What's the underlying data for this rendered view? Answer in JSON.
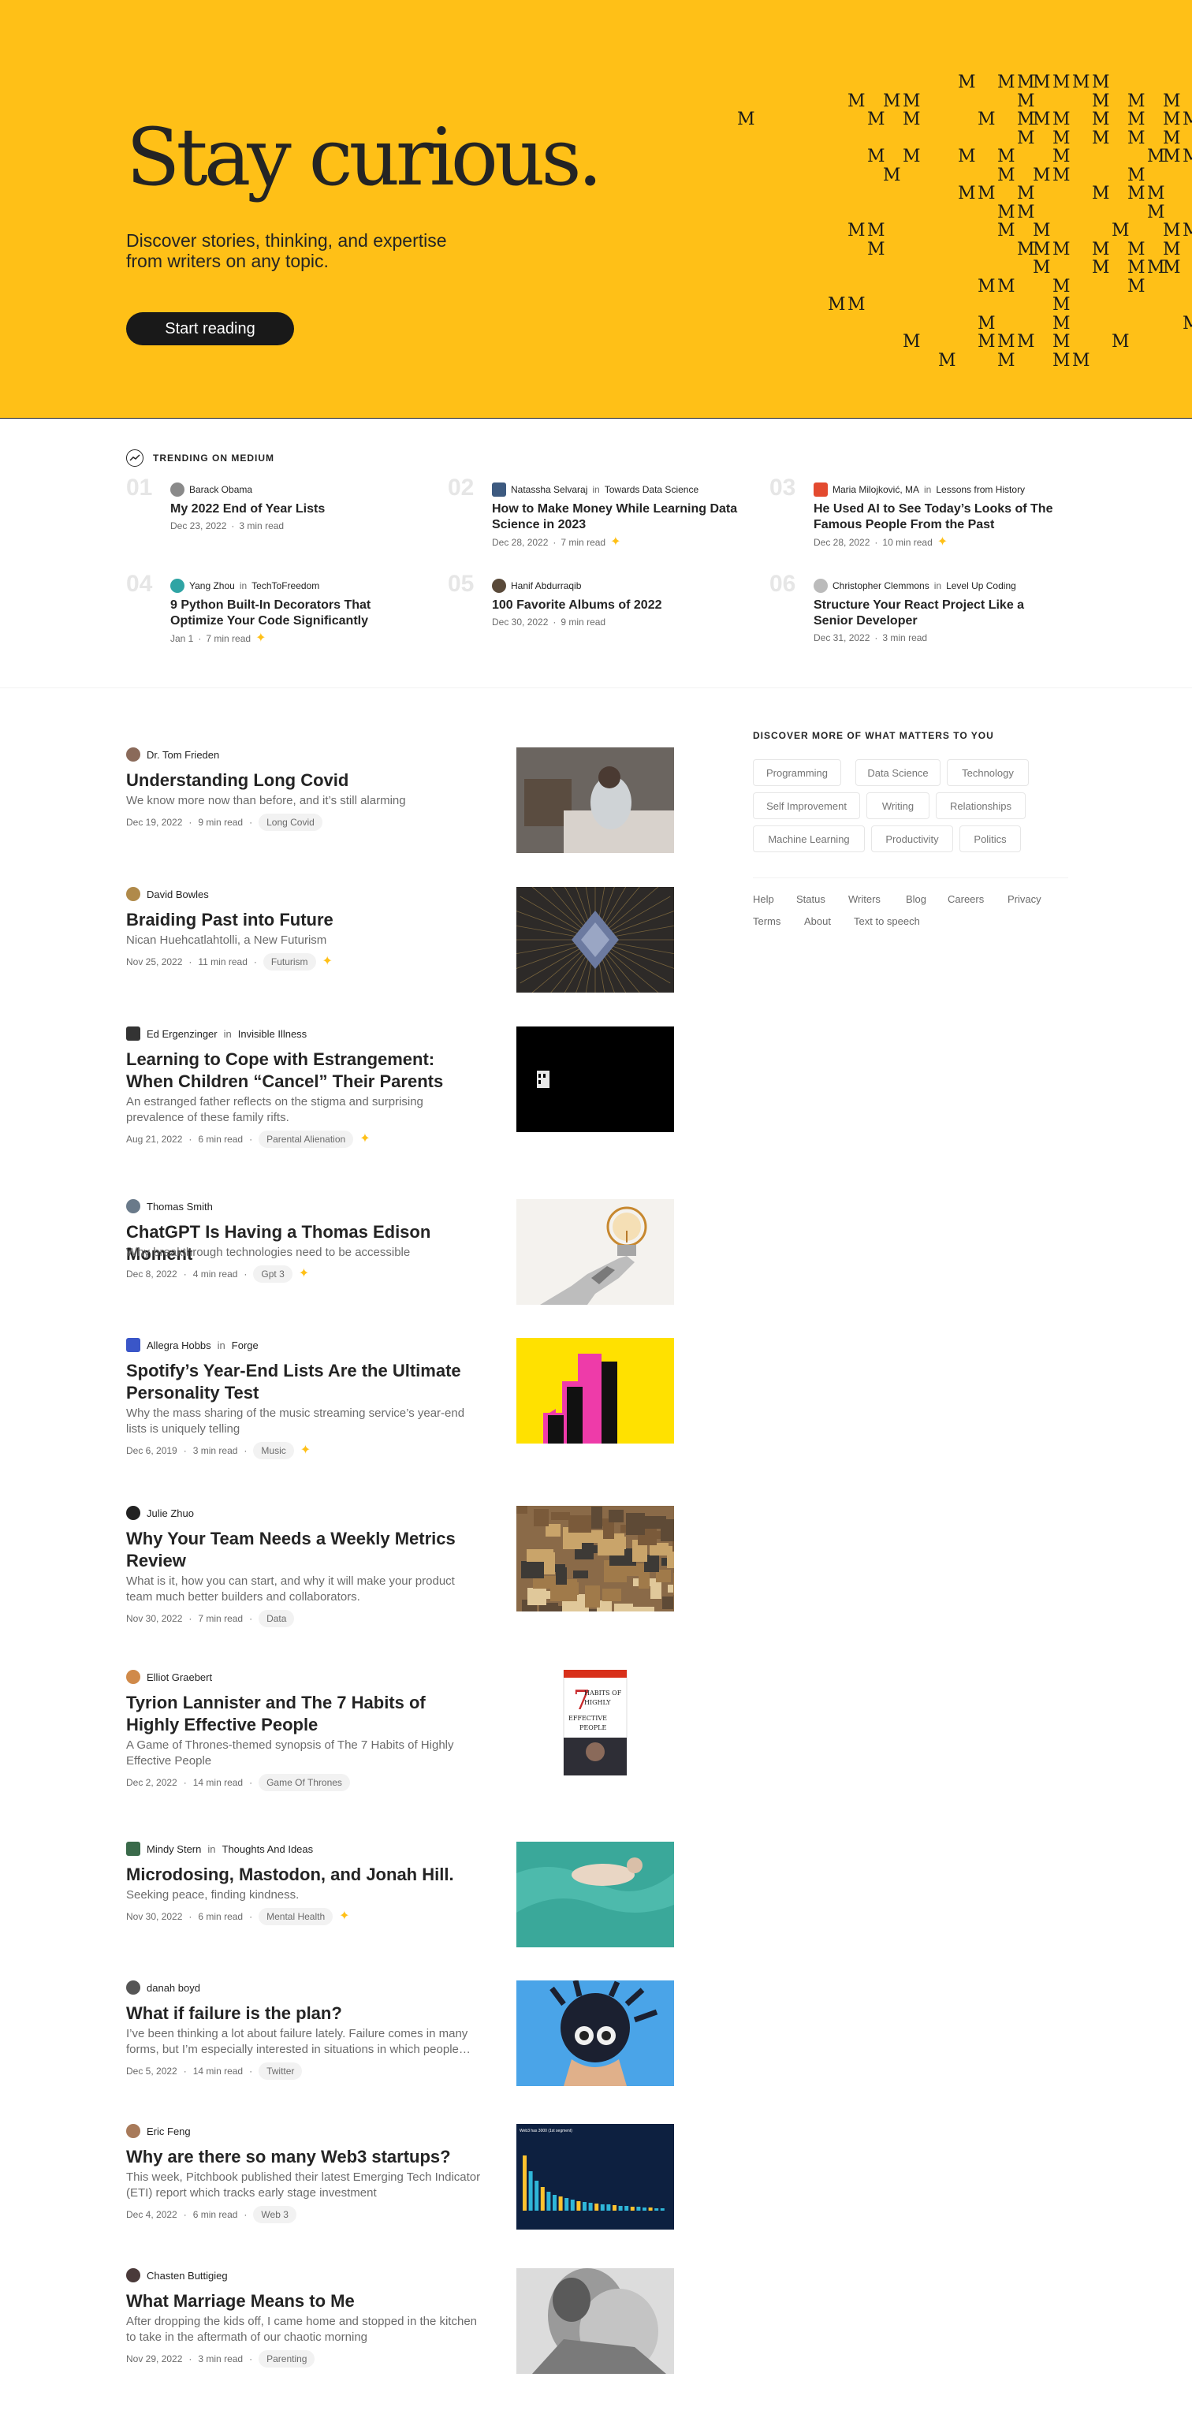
{
  "hero": {
    "title": "Stay curious.",
    "subtitle": "Discover stories, thinking, and expertise from writers on any topic.",
    "cta": "Start reading",
    "pattern_glyph": "M",
    "background": "#ffc017"
  },
  "trending": {
    "label": "TRENDING ON MEDIUM",
    "items": [
      {
        "num": "01",
        "author": "Barack Obama",
        "publication": "",
        "in": "",
        "title": "My 2022 End of Year Lists",
        "date": "Dec 23, 2022",
        "read": "3 min read",
        "member": false
      },
      {
        "num": "02",
        "author": "Natassha Selvaraj",
        "in": "in",
        "publication": "Towards Data Science",
        "title": "How to Make Money While Learning Data Science in 2023",
        "date": "Dec 28, 2022",
        "read": "7 min read",
        "member": true
      },
      {
        "num": "03",
        "author": "Maria Milojković, MA",
        "in": "in",
        "publication": "Lessons from History",
        "title": "He Used AI to See Today’s Looks of The Famous People From the Past",
        "date": "Dec 28, 2022",
        "read": "10 min read",
        "member": true
      },
      {
        "num": "04",
        "author": "Yang Zhou",
        "in": "in",
        "publication": "TechToFreedom",
        "title": "9 Python Built-In Decorators That Optimize Your Code Significantly",
        "date": "Jan 1",
        "read": "7 min read",
        "member": true
      },
      {
        "num": "05",
        "author": "Hanif Abdurraqib",
        "publication": "",
        "in": "",
        "title": "100 Favorite Albums of 2022",
        "date": "Dec 30, 2022",
        "read": "9 min read",
        "member": false
      },
      {
        "num": "06",
        "author": "Christopher Clemmons",
        "in": "in",
        "publication": "Level Up Coding",
        "title": "Structure Your React Project Like a Senior Developer",
        "date": "Dec 31, 2022",
        "read": "3 min read",
        "member": false
      }
    ]
  },
  "feed": [
    {
      "author": "Dr. Tom Frieden",
      "in": "",
      "publication": "",
      "title": "Understanding Long Covid",
      "desc": "We know more now than before, and it’s still alarming",
      "date": "Dec 19, 2022",
      "read": "9 min read",
      "tag": "Long Covid",
      "member": false
    },
    {
      "author": "David Bowles",
      "in": "",
      "publication": "",
      "title": "Braiding Past into Future",
      "desc": "Nican Huehcatlahtolli, a New Futurism",
      "date": "Nov 25, 2022",
      "read": "11 min read",
      "tag": "Futurism",
      "member": true
    },
    {
      "author": "Ed Ergenzinger",
      "in": "in",
      "publication": "Invisible Illness",
      "title": "Learning to Cope with Estrangement: When Children “Cancel” Their Parents",
      "desc": "An estranged father reflects on the stigma and surprising prevalence of these family rifts.",
      "date": "Aug 21, 2022",
      "read": "6 min read",
      "tag": "Parental Alienation",
      "member": true
    },
    {
      "author": "Thomas Smith",
      "in": "",
      "publication": "",
      "title": "ChatGPT Is Having a Thomas Edison Moment",
      "desc": "Why breakthrough technologies need to be accessible",
      "date": "Dec 8, 2022",
      "read": "4 min read",
      "tag": "Gpt 3",
      "member": true
    },
    {
      "author": "Allegra Hobbs",
      "in": "in",
      "publication": "Forge",
      "title": "Spotify’s Year-End Lists Are the Ultimate Personality Test",
      "desc": "Why the mass sharing of the music streaming service’s year-end lists is uniquely telling",
      "date": "Dec 6, 2019",
      "read": "3 min read",
      "tag": "Music",
      "member": true
    },
    {
      "author": "Julie Zhuo",
      "in": "",
      "publication": "",
      "title": "Why Your Team Needs a Weekly Metrics Review",
      "desc": "What is it, how you can start, and why it will make your product team much better builders and collaborators.",
      "date": "Nov 30, 2022",
      "read": "7 min read",
      "tag": "Data",
      "member": false
    },
    {
      "author": "Elliot Graebert",
      "in": "",
      "publication": "",
      "title": "Tyrion Lannister and The 7 Habits of Highly Effective People",
      "desc": "A Game of Thrones-themed synopsis of The 7 Habits of Highly Effective People",
      "date": "Dec 2, 2022",
      "read": "14 min read",
      "tag": "Game Of Thrones",
      "member": false
    },
    {
      "author": "Mindy Stern",
      "in": "in",
      "publication": "Thoughts And Ideas",
      "title": "Microdosing, Mastodon, and Jonah Hill.",
      "desc": "Seeking peace, finding kindness.",
      "date": "Nov 30, 2022",
      "read": "6 min read",
      "tag": "Mental Health",
      "member": true
    },
    {
      "author": "danah boyd",
      "in": "",
      "publication": "",
      "title": "What if failure is the plan?",
      "desc": "I’ve been thinking a lot about failure lately. Failure comes in many forms, but I’m especially interested in situations in which people…",
      "date": "Dec 5, 2022",
      "read": "14 min read",
      "tag": "Twitter",
      "member": false
    },
    {
      "author": "Eric Feng",
      "in": "",
      "publication": "",
      "title": "Why are there so many Web3 startups?",
      "desc": "This week, Pitchbook published their latest Emerging Tech Indicator (ETI) report which tracks early stage investment",
      "date": "Dec 4, 2022",
      "read": "6 min read",
      "tag": "Web 3",
      "member": false
    },
    {
      "author": "Chasten Buttigieg",
      "in": "",
      "publication": "",
      "title": "What Marriage Means to Me",
      "desc": "After dropping the kids off, I came home and stopped in the kitchen to take in the aftermath of our chaotic morning",
      "date": "Nov 29, 2022",
      "read": "3 min read",
      "tag": "Parenting",
      "member": false
    }
  ],
  "sidebar": {
    "heading": "DISCOVER MORE OF WHAT MATTERS TO YOU",
    "topics": [
      "Programming",
      "Data Science",
      "Technology",
      "Self Improvement",
      "Writing",
      "Relationships",
      "Machine Learning",
      "Productivity",
      "Politics"
    ],
    "footer_links": [
      "Help",
      "Status",
      "Writers",
      "Blog",
      "Careers",
      "Privacy",
      "Terms",
      "About",
      "Text to speech"
    ]
  },
  "misc": {
    "member_star": "✦",
    "seven_habits_cover": {
      "number": "7",
      "line1": "HABITS OF",
      "line2": "HIGHLY",
      "line3": "EFFECTIVE",
      "line4": "PEOPLE"
    },
    "chart_thumb_title": "Web3 has 3000 (1st segment)"
  }
}
